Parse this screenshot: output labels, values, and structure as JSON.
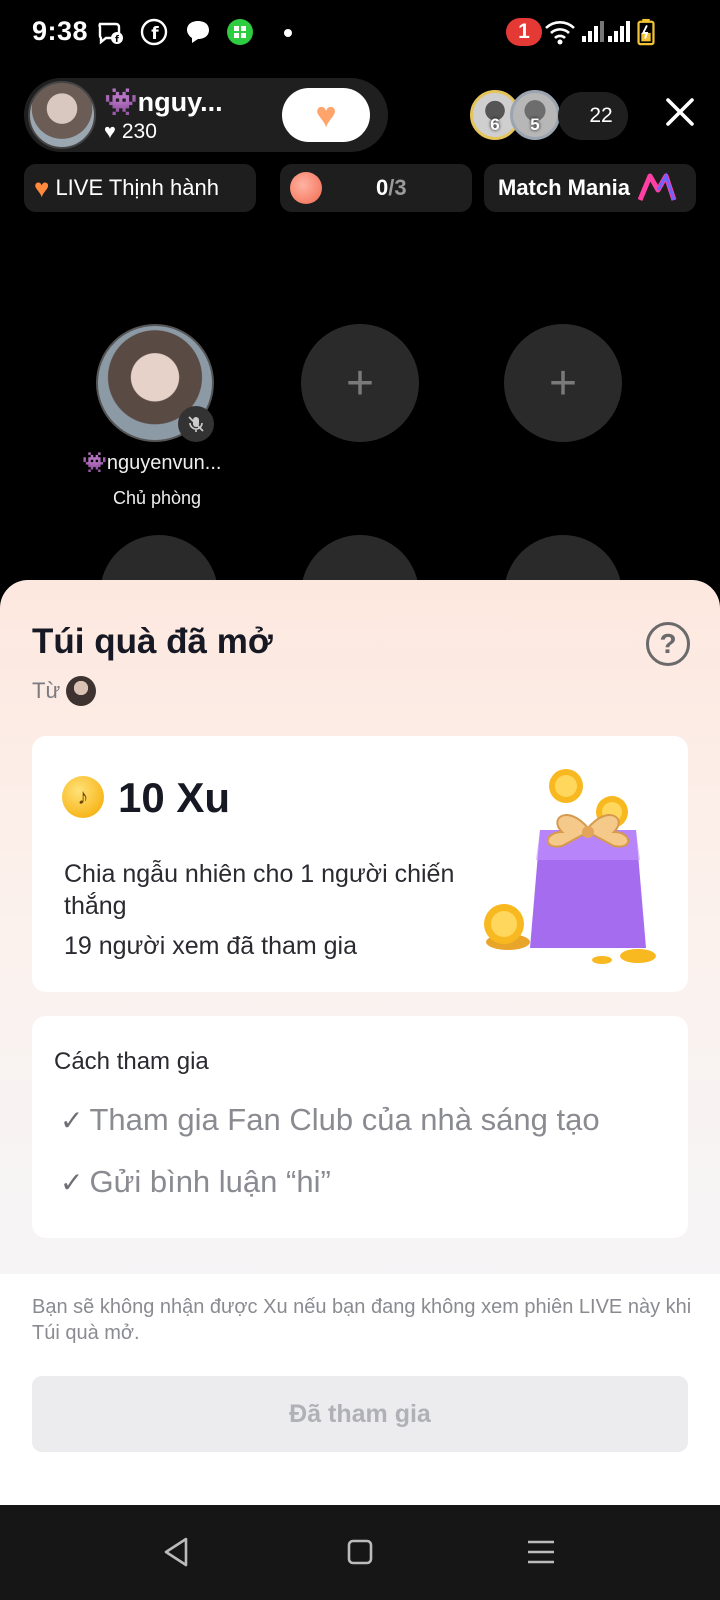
{
  "status_bar": {
    "time": "9:38",
    "notification_count": "1",
    "icons": [
      "messenger-icon",
      "facebook-icon",
      "chat-icon",
      "app-icon",
      "wifi-icon",
      "signal-icon",
      "signal-icon",
      "battery-icon"
    ]
  },
  "live_header": {
    "host_name": "👾nguy...",
    "host_likes": "230",
    "follow_heart_count": "1",
    "viewer_badges": [
      "6",
      "5"
    ],
    "viewer_count": "22"
  },
  "chips": {
    "trending_label": "LIVE Thịnh hành",
    "task_progress_current": "0",
    "task_progress_total": "/3",
    "match_label": "Match Mania"
  },
  "seats": {
    "host_seat_name": "👾nguyenvun...",
    "host_seat_role": "Chủ phòng"
  },
  "gift_sheet": {
    "title": "Túi quà đã mở",
    "from_label": "Từ",
    "amount": "10 Xu",
    "description": "Chia ngẫu nhiên cho 1 người chiến thắng",
    "participants": "19 người xem đã tham gia",
    "how_title": "Cách tham gia",
    "requirements": [
      "Tham gia Fan Club của nhà sáng tạo",
      "Gửi bình luận “hi”"
    ],
    "notice": "Bạn sẽ không nhận được Xu nếu bạn đang không xem phiên LIVE này khi Túi quà mở.",
    "button_label": "Đã tham gia"
  },
  "colors": {
    "accent_coin": "#f8b81f",
    "badge_red": "#e53935",
    "gift_bag": "#a66cf0"
  }
}
